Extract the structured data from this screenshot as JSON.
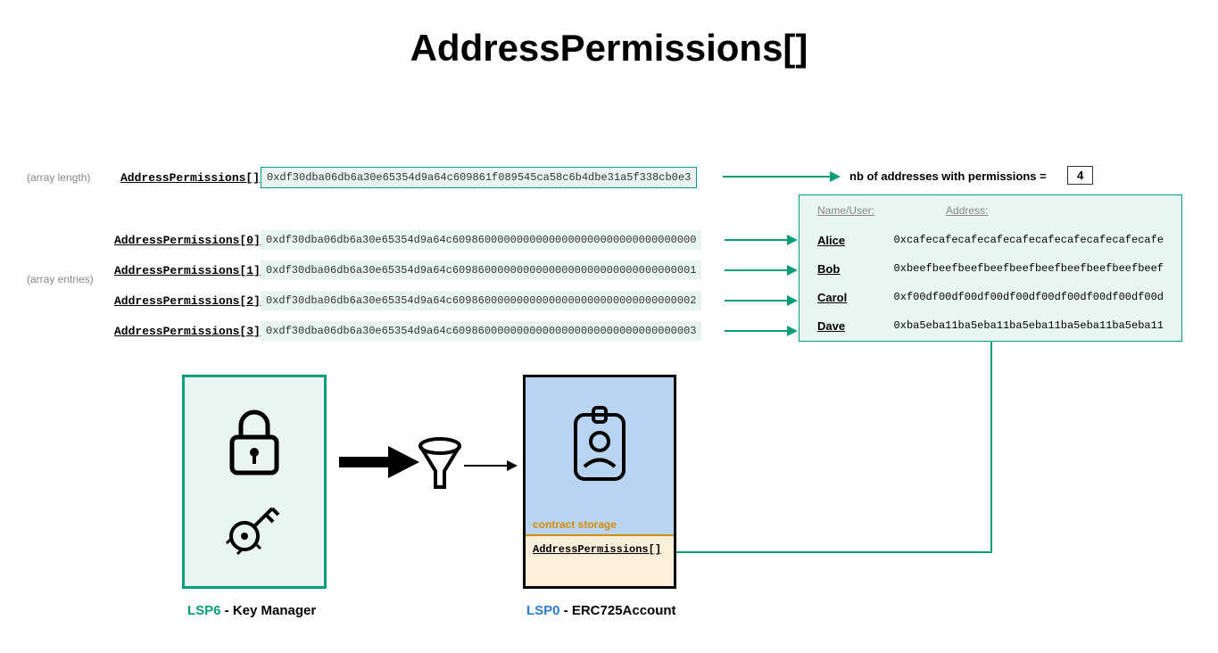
{
  "title": "AddressPermissions[]",
  "labels": {
    "array_length": "(array length)",
    "array_entries": "(array entries)",
    "nb_addresses": "nb of addresses with permissions =",
    "nb_value": "4"
  },
  "length_key": {
    "name": "AddressPermissions[]",
    "hex": "0xdf30dba06db6a30e65354d9a64c609861f089545ca58c6b4dbe31a5f338cb0e3"
  },
  "entries": [
    {
      "name": "AddressPermissions[0]",
      "hex": "0xdf30dba06db6a30e65354d9a64c60986000000000000000000000000000000000"
    },
    {
      "name": "AddressPermissions[1]",
      "hex": "0xdf30dba06db6a30e65354d9a64c60986000000000000000000000000000000001"
    },
    {
      "name": "AddressPermissions[2]",
      "hex": "0xdf30dba06db6a30e65354d9a64c60986000000000000000000000000000000002"
    },
    {
      "name": "AddressPermissions[3]",
      "hex": "0xdf30dba06db6a30e65354d9a64c60986000000000000000000000000000000003"
    }
  ],
  "users_panel": {
    "header": {
      "name": "Name/User:",
      "address": "Address:"
    },
    "rows": [
      {
        "name": "Alice",
        "address": "0xcafecafecafecafecafecafecafecafecafecafe"
      },
      {
        "name": "Bob",
        "address": "0xbeefbeefbeefbeefbeefbeefbeefbeefbeefbeef"
      },
      {
        "name": "Carol",
        "address": "0xf00df00df00df00df00df00df00df00df00df00d"
      },
      {
        "name": "Dave",
        "address": "0xba5eba11ba5eba11ba5eba11ba5eba11ba5eba11"
      }
    ]
  },
  "boxes": {
    "lsp6": {
      "prefix": "LSP6",
      "suffix": " - Key Manager"
    },
    "lsp0": {
      "prefix": "LSP0",
      "suffix": " - ERC725Account",
      "storage_label": "contract storage",
      "storage_item": "AddressPermissions[]"
    }
  }
}
